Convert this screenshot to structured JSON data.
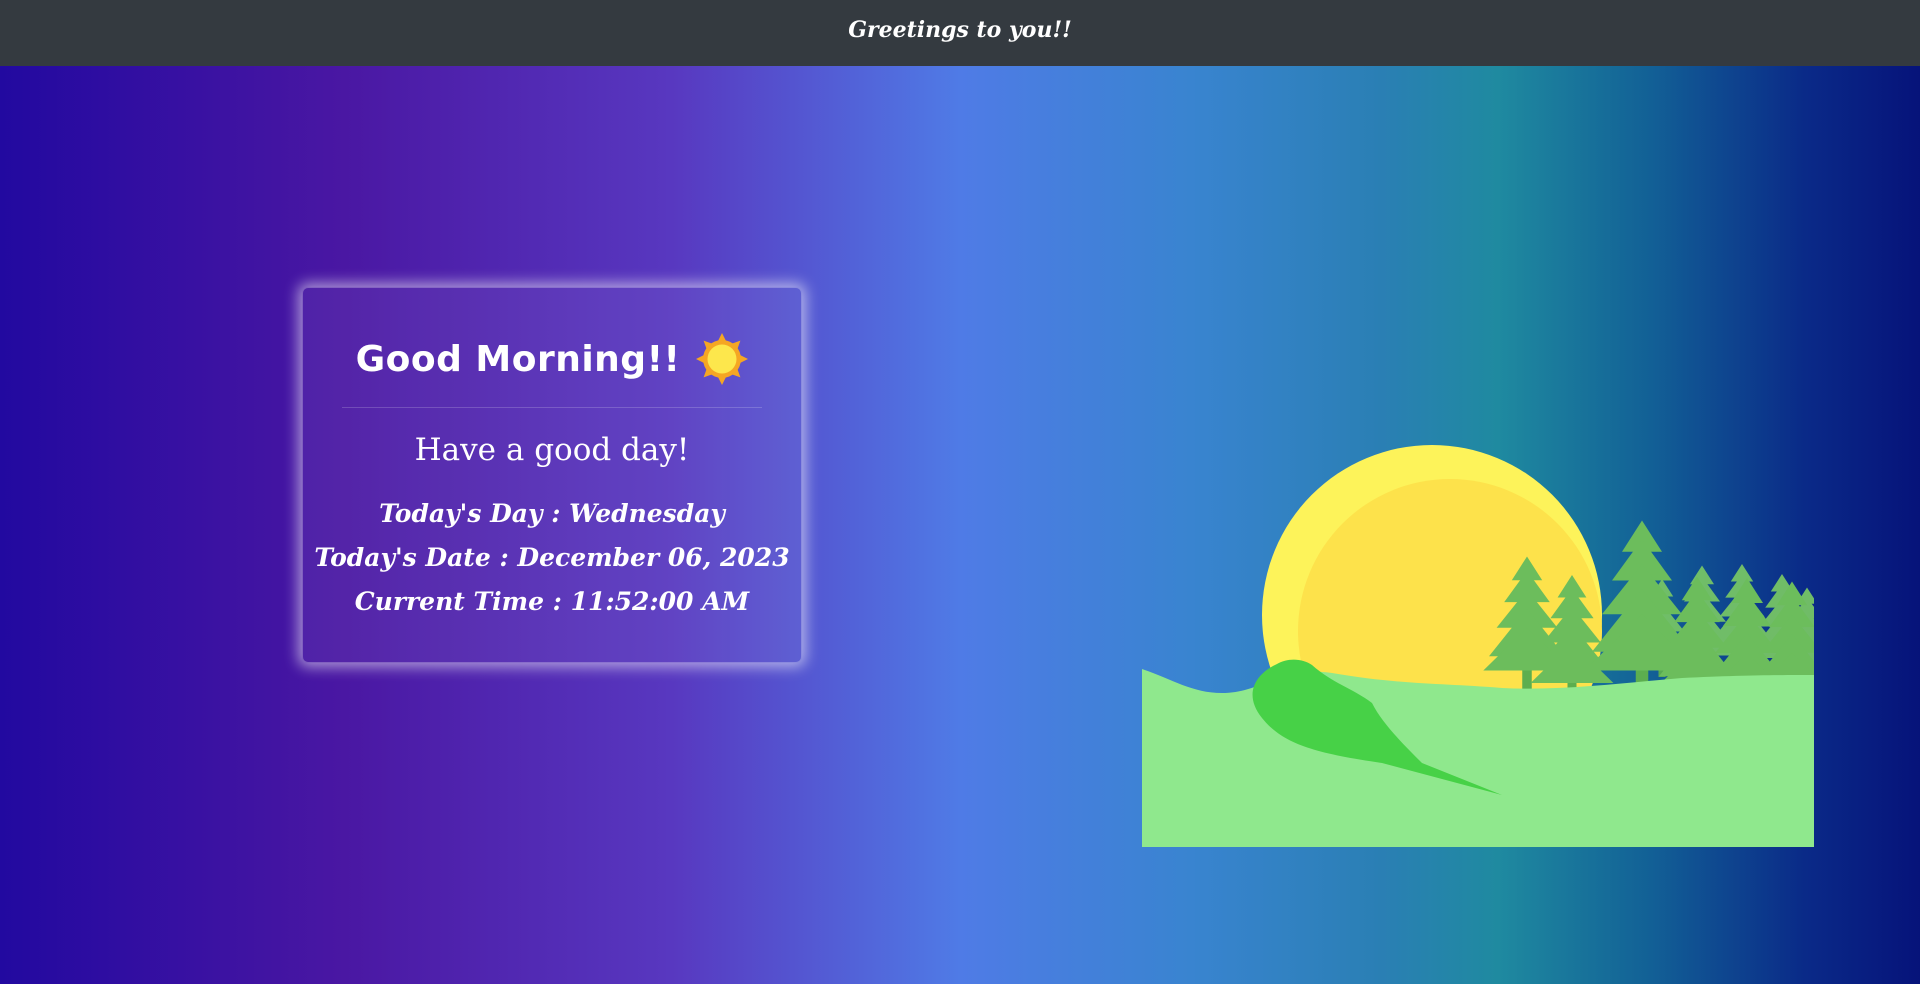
{
  "navbar": {
    "title": "Greetings to you!!"
  },
  "card": {
    "greeting": "Good Morning!!",
    "greeting_icon": "sun-icon",
    "wish": "Have a good day!",
    "day_line": "Today's Day : Wednesday",
    "date_line": "Today's Date : December 06, 2023",
    "time_line": "Current Time : 11:52:00 AM"
  },
  "illustration": {
    "name": "sunrise-landscape",
    "colors": {
      "sun_outer": "#fdf35a",
      "sun_inner": "#fde24b",
      "hill": "#8fe88d",
      "bush": "#47d147",
      "trees": "#6fbf5e"
    }
  },
  "colors": {
    "navbar": "#343a40",
    "background_left": "#2209a0",
    "background_mid": "#4f7be6",
    "background_right": "#06137a"
  }
}
